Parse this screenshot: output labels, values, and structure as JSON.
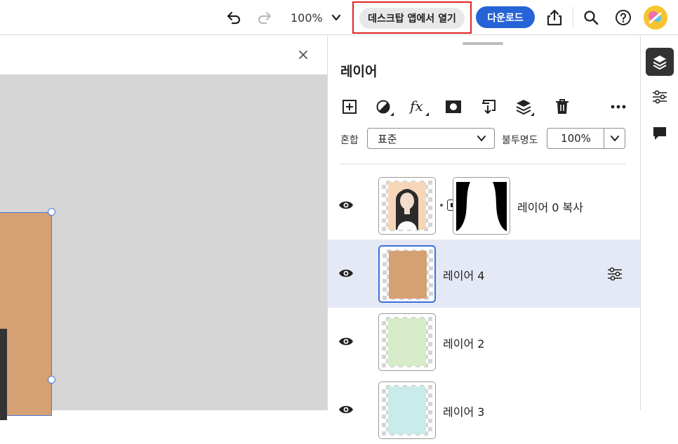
{
  "toolbar": {
    "zoom": "100%",
    "open_desktop_label": "데스크탑 앱에서 열기",
    "download_label": "다운로드"
  },
  "panel": {
    "title": "레이어",
    "blend_label": "혼합",
    "blend_value": "표준",
    "opacity_label": "불투명도",
    "opacity_value": "100%"
  },
  "layers": [
    {
      "name": "레이어 0 복사",
      "visible": true,
      "selected": false,
      "has_mask": true
    },
    {
      "name": "레이어 4",
      "visible": true,
      "selected": true,
      "fill": "#d4a074"
    },
    {
      "name": "레이어 2",
      "visible": true,
      "selected": false,
      "fill": "#d6ecc8"
    },
    {
      "name": "레이어 3",
      "visible": true,
      "selected": false,
      "fill": "#c9ebea"
    }
  ],
  "colors": {
    "accent": "#2663d6",
    "selected_row": "#e4e9f5",
    "artwork": "#d4a074"
  },
  "icons": {
    "undo": "undo-icon",
    "redo": "redo-icon",
    "share": "share-icon",
    "search": "search-icon",
    "help": "help-icon",
    "layers_rail": "layers-icon",
    "adjustments_rail": "sliders-icon",
    "comments_rail": "comment-icon"
  }
}
